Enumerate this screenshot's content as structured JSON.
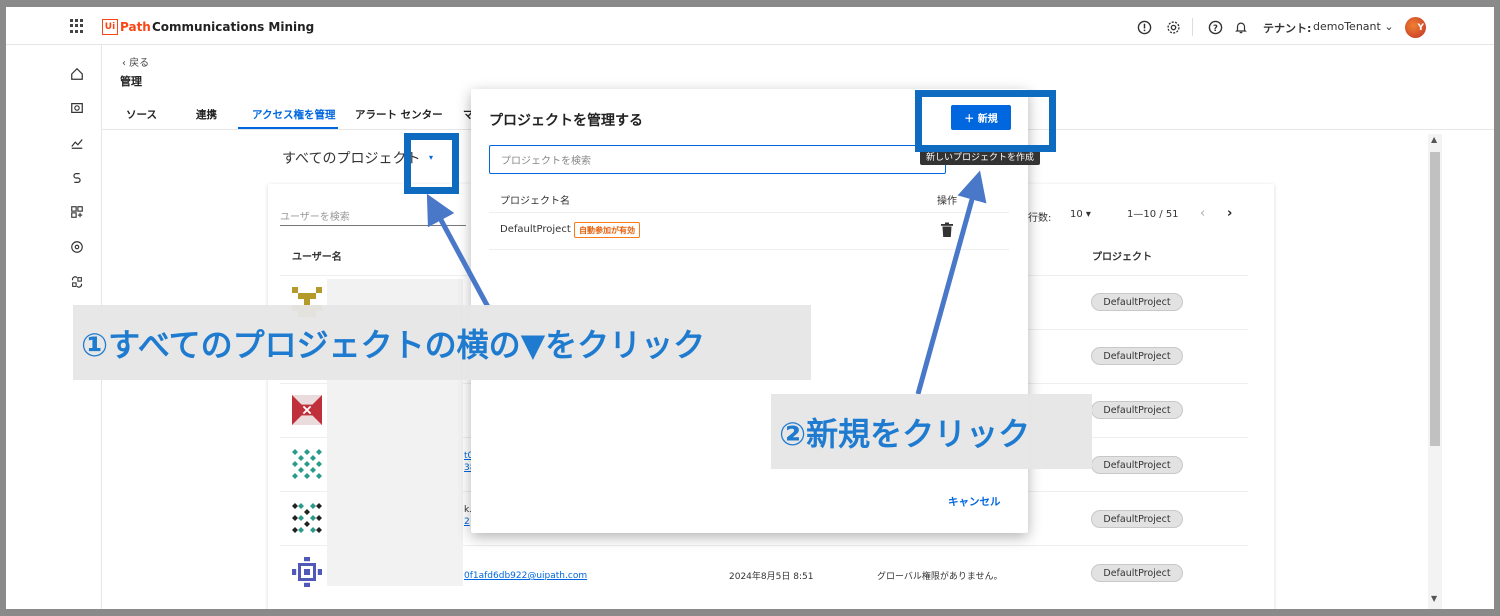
{
  "topbar": {
    "logo_ui": "Ui",
    "logo_path": "Path",
    "app_name": "Communications Mining",
    "tenant_label": "テナント:",
    "tenant_value": "demoTenant",
    "avatar_text": "Y"
  },
  "header": {
    "back_label": "‹ 戻る",
    "page_title": "管理",
    "tabs": [
      {
        "label": "ソース"
      },
      {
        "label": "連携"
      },
      {
        "label": "アクセス権を管理"
      },
      {
        "label": "アラート センター"
      },
      {
        "label": "マ"
      }
    ]
  },
  "project_selector": {
    "label": "すべてのプロジェクト",
    "caret": "▾"
  },
  "user_table": {
    "search_placeholder": "ユーザーを検索",
    "col_user": "ユーザー名",
    "col_project": "プロジェクト",
    "rows_per_page_label": "行数:",
    "rows_per_page_value": "10 ▾",
    "range": "1—10 / 51",
    "prev": "‹",
    "next": "›",
    "project_chips": [
      "DefaultProject",
      "DefaultProject",
      "DefaultProject",
      "DefaultProject",
      "DefaultProject",
      "DefaultProject"
    ],
    "partial_texts": [
      "t0",
      "38",
      "k.",
      "2"
    ],
    "last_row": {
      "email": "0f1afd6db922@uipath.com",
      "date": "2024年8月5日 8:51",
      "permission": "グローバル権限がありません。"
    }
  },
  "modal": {
    "title": "プロジェクトを管理する",
    "new_button": "＋ 新規",
    "tooltip": "新しいプロジェクトを作成",
    "search_placeholder": "プロジェクトを検索",
    "col_name": "プロジェクト名",
    "col_ops": "操作",
    "project_name": "DefaultProject",
    "auto_badge": "自動参加が有効",
    "cancel": "キャンセル"
  },
  "annotations": {
    "step1": "①すべてのプロジェクトの横の▼をクリック",
    "step2": "②新規をクリック",
    "accent_color": "#1e7bcf"
  }
}
